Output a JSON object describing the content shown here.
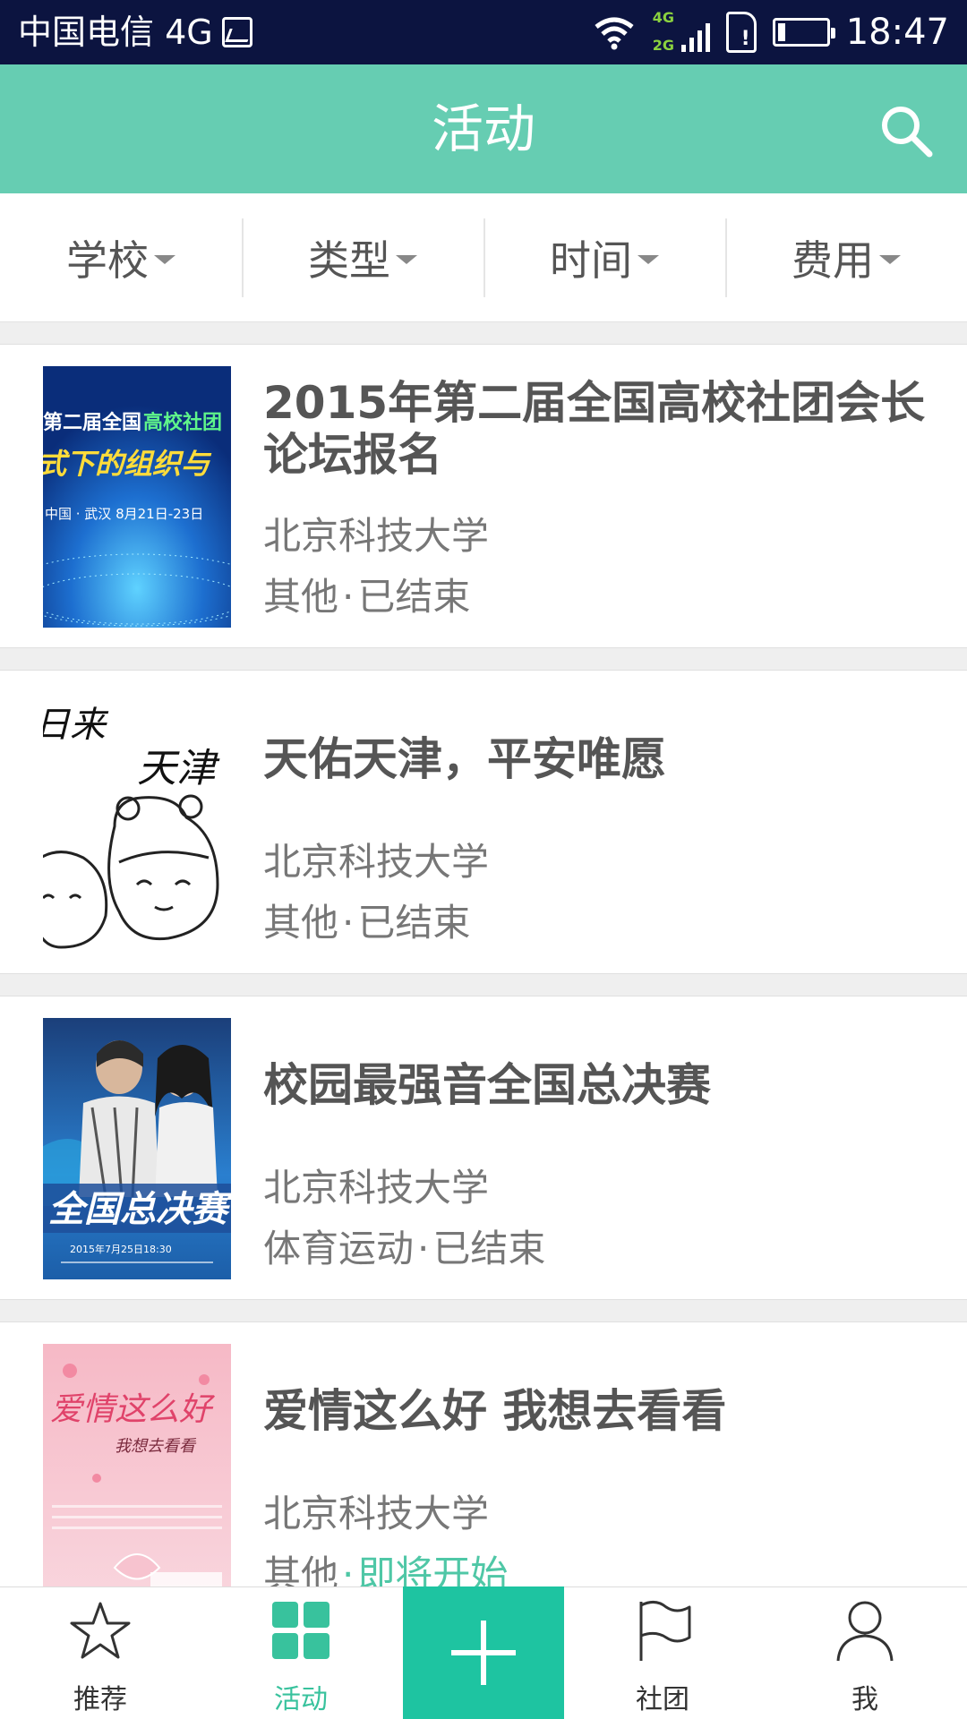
{
  "status_bar": {
    "carrier": "中国电信 4G",
    "time": "18:47",
    "net_top": "4G",
    "net_bottom": "2G"
  },
  "app_bar": {
    "title": "活动",
    "search_icon": "search-icon"
  },
  "filters": [
    "学校",
    "类型",
    "时间",
    "费用"
  ],
  "activities": [
    {
      "title": "2015年第二届全国高校社团会长论坛报名",
      "school": "北京科技大学",
      "category": "其他",
      "separator": "·",
      "status": "已结束",
      "status_color": "#777777"
    },
    {
      "title": "天佑天津，平安唯愿",
      "school": "北京科技大学",
      "category": "其他",
      "separator": "·",
      "status": "已结束",
      "status_color": "#777777"
    },
    {
      "title": "校园最强音全国总决赛",
      "school": "北京科技大学",
      "category": "体育运动",
      "separator": "·",
      "status": "已结束",
      "status_color": "#777777"
    },
    {
      "title": "爱情这么好  我想去看看",
      "school": "北京科技大学",
      "category": "其他",
      "separator": "·",
      "status": "即将开始",
      "status_color": "#4fc7a6"
    }
  ],
  "thumbs": {
    "t1_line1": "第二届全国",
    "t1_line1b": "高校社团",
    "t1_line2": "式下的组织与",
    "t1_line3": "中国 · 武汉   8月21日-23日",
    "t2_text1": "日来",
    "t2_text2": "天津",
    "t3_text": "全国总决赛",
    "t3_small": "2015年7月25日18:30",
    "t4_text1": "爱情这么好",
    "t4_text2": "我想去看看"
  },
  "bottom_nav": [
    {
      "label": "推荐",
      "icon": "star-icon"
    },
    {
      "label": "活动",
      "icon": "grid-icon"
    },
    {
      "label": "社团",
      "icon": "flag-icon"
    },
    {
      "label": "我",
      "icon": "person-icon"
    }
  ],
  "colors": {
    "accent": "#66cdb2",
    "plus_button": "#1ec4a1",
    "active_nav": "#38c29d",
    "status_bar": "#0c1440"
  }
}
